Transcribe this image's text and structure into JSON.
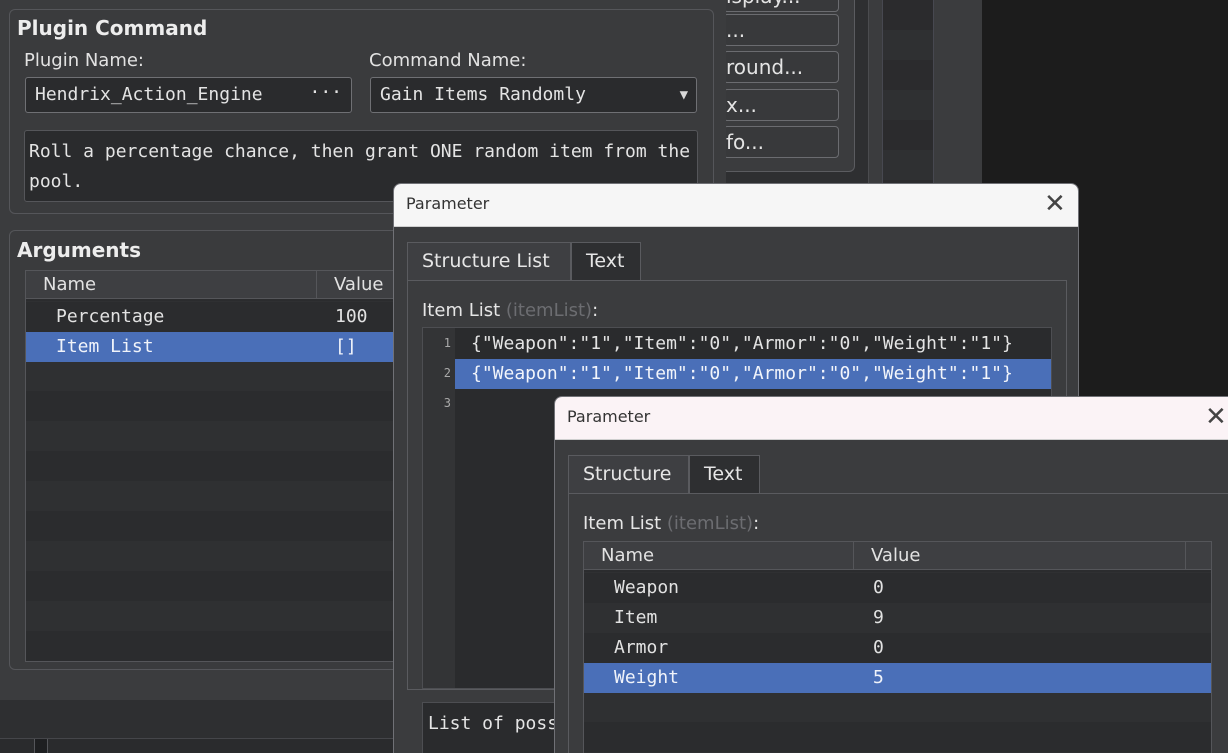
{
  "background": {
    "panel_buttons": [
      "...",
      "round...",
      "x...",
      "fo..."
    ]
  },
  "plugin_command": {
    "title": "Plugin Command",
    "plugin_name_label": "Plugin Name:",
    "plugin_name_value": "Hendrix_Action_Engine",
    "plugin_name_button": "···",
    "command_name_label": "Command Name:",
    "command_name_value": "Gain Items Randomly",
    "command_name_arrow": "▼",
    "description": "Roll a percentage chance, then grant ONE random item from the pool."
  },
  "arguments": {
    "title": "Arguments",
    "columns": [
      "Name",
      "Value"
    ],
    "rows": [
      {
        "name": "Percentage",
        "value": "100"
      },
      {
        "name": "Item List",
        "value": "[]"
      }
    ]
  },
  "dialog1": {
    "title": "Parameter",
    "close_glyph": "✕",
    "tabs": [
      "Structure List",
      "Text"
    ],
    "label_main": "Item List",
    "label_key": "(itemList)",
    "label_colon": ":",
    "line_numbers": [
      "1",
      "2",
      "3"
    ],
    "lines": [
      "{\"Weapon\":\"1\",\"Item\":\"0\",\"Armor\":\"0\",\"Weight\":\"1\"}",
      "{\"Weapon\":\"1\",\"Item\":\"0\",\"Armor\":\"0\",\"Weight\":\"1\"}"
    ],
    "description": "List of poss"
  },
  "dialog2": {
    "title": "Parameter",
    "close_glyph": "✕",
    "tabs": [
      "Structure",
      "Text"
    ],
    "label_main": "Item List",
    "label_key": "(itemList)",
    "label_colon": ":",
    "columns": [
      "Name",
      "Value"
    ],
    "rows": [
      {
        "name": "Weapon",
        "value": "0"
      },
      {
        "name": "Item",
        "value": "9"
      },
      {
        "name": "Armor",
        "value": "0"
      },
      {
        "name": "Weight",
        "value": "5"
      }
    ]
  },
  "colors": {
    "selection": "#4a6fb8",
    "panel": "#3b3c3e",
    "field": "#2a2b2d"
  }
}
